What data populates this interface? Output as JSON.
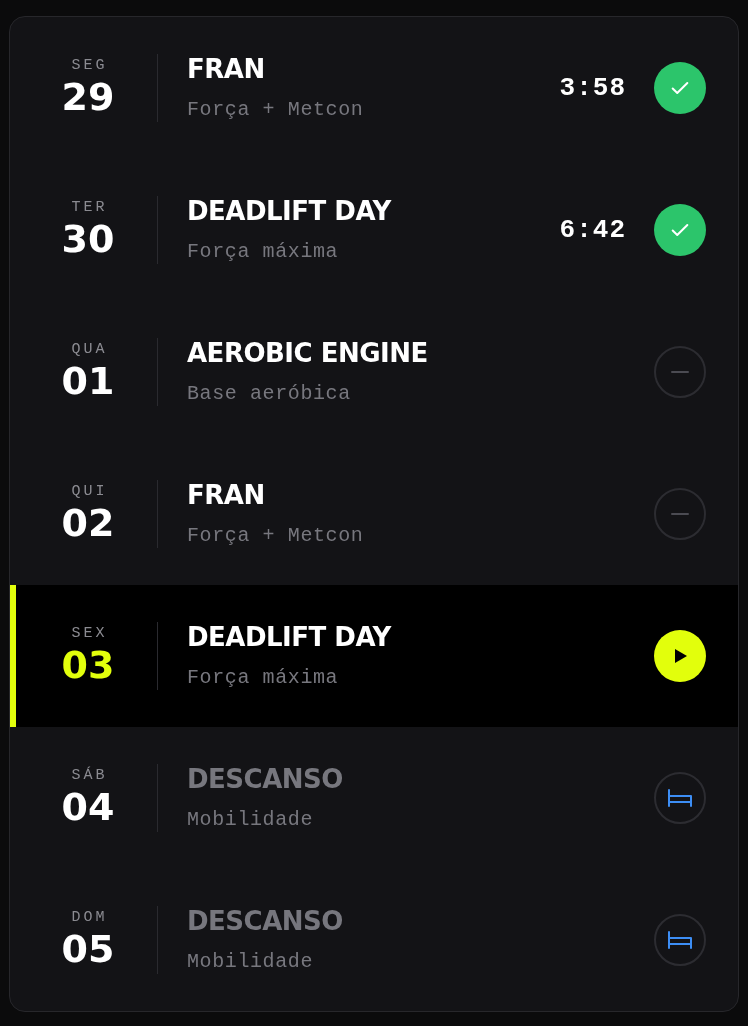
{
  "rows": [
    {
      "day": "SEG",
      "date": "29",
      "title": "FRAN",
      "subtitle": "Força + Metcon",
      "time": "3:58",
      "kind": "done",
      "selected": false
    },
    {
      "day": "TER",
      "date": "30",
      "title": "DEADLIFT DAY",
      "subtitle": "Força máxima",
      "time": "6:42",
      "kind": "done",
      "selected": false
    },
    {
      "day": "QUA",
      "date": "01",
      "title": "AEROBIC ENGINE",
      "subtitle": "Base aeróbica",
      "kind": "skipped",
      "selected": false
    },
    {
      "day": "QUI",
      "date": "02",
      "title": "FRAN",
      "subtitle": "Força + Metcon",
      "kind": "skipped",
      "selected": false
    },
    {
      "day": "SEX",
      "date": "03",
      "title": "DEADLIFT DAY",
      "subtitle": "Força máxima",
      "kind": "today",
      "selected": true
    },
    {
      "day": "SÁB",
      "date": "04",
      "title": "DESCANSO",
      "subtitle": "Mobilidade",
      "kind": "rest",
      "selected": false
    },
    {
      "day": "DOM",
      "date": "05",
      "title": "DESCANSO",
      "subtitle": "Mobilidade",
      "kind": "rest",
      "selected": false
    }
  ]
}
